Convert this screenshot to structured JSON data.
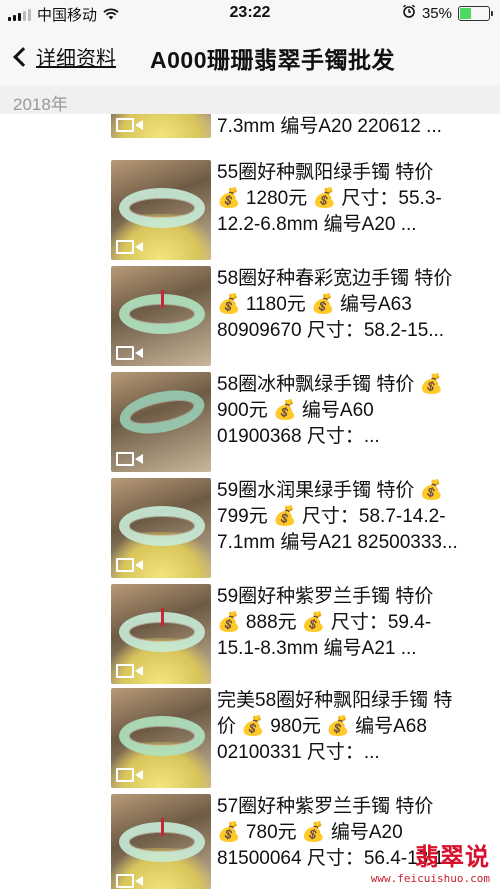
{
  "status_bar": {
    "carrier": "中国移动",
    "time": "23:22",
    "battery": "35%",
    "battery_level": 0.35
  },
  "nav": {
    "back_label": "详细资料",
    "title": "A000珊珊翡翠手镯批发"
  },
  "year_label": "2018年",
  "items": [
    {
      "lines": [
        "7.3mm 编号A20 220612 ..."
      ]
    },
    {
      "lines": [
        "55圈好种飘阳绿手镯 特价",
        "💰 1280元 💰 尺寸：55.3-",
        "12.2-6.8mm 编号A20 ..."
      ]
    },
    {
      "lines": [
        "58圈好种春彩宽边手镯 特价",
        "💰 1180元 💰 编号A63",
        "80909670 尺寸：58.2-15..."
      ]
    },
    {
      "lines": [
        "58圈冰种飘绿手镯 特价 💰",
        "900元 💰 编号A60",
        "01900368 尺寸：..."
      ]
    },
    {
      "lines": [
        "59圈水润果绿手镯 特价 💰",
        "799元 💰 尺寸：58.7-14.2-",
        "7.1mm 编号A21 82500333..."
      ]
    },
    {
      "lines": [
        "59圈好种紫罗兰手镯 特价",
        "💰 888元 💰 尺寸：59.4-",
        "15.1-8.3mm 编号A21 ..."
      ]
    },
    {
      "lines": [
        "完美58圈好种飘阳绿手镯 特",
        "价 💰 980元 💰 编号A68",
        "02100331 尺寸：..."
      ]
    },
    {
      "lines": [
        "57圈好种紫罗兰手镯 特价",
        "💰 780元 💰 编号A20",
        "81500064 尺寸：56.4-13.1..."
      ]
    }
  ],
  "watermark": {
    "main": "翡翠说",
    "url": "www.feicuishuo.com"
  }
}
